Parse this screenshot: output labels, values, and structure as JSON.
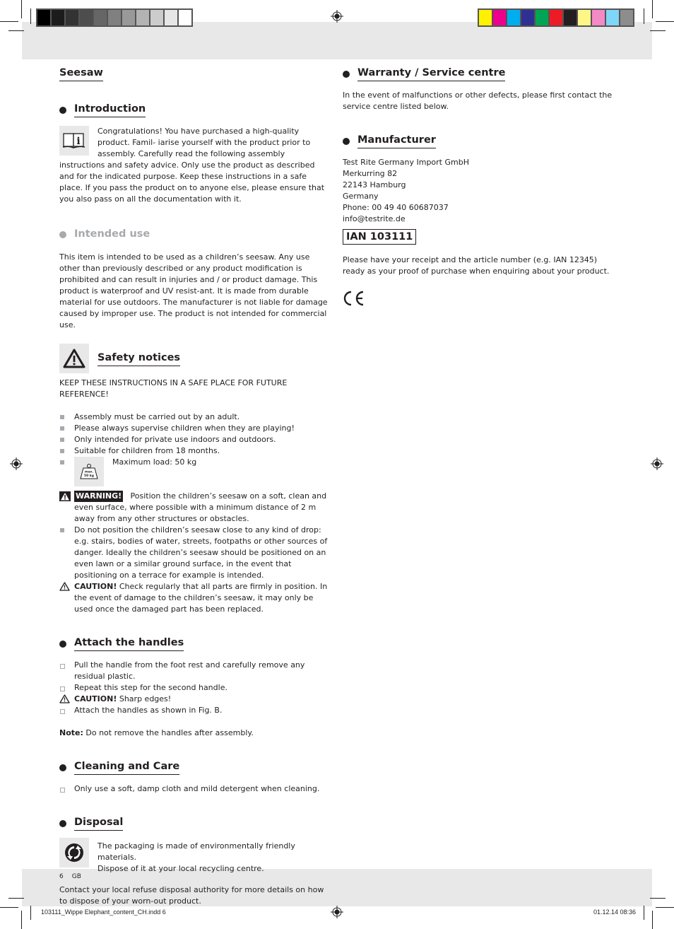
{
  "print_marks": {
    "grey_swatches": [
      "#000000",
      "#1c1c1c",
      "#333333",
      "#4d4d4d",
      "#666666",
      "#808080",
      "#999999",
      "#b3b3b3",
      "#cccccc",
      "#e6e6e6",
      "#ffffff"
    ],
    "color_swatches": [
      "#fff200",
      "#ec008c",
      "#00aeef",
      "#2e3192",
      "#00a651",
      "#ed1c24",
      "#231f20",
      "#fff688",
      "#f389c5",
      "#7fd6f7",
      "#8d8d8d"
    ],
    "slug_file": "103111_Wippe Elephant_content_CH.indd   6",
    "slug_date": "01.12.14   08:36"
  },
  "page_title": "Seesaw",
  "introduction": {
    "heading": "Introduction",
    "icon": "info-book-icon",
    "text_wrapped": [
      "Congratulations! You have purchased a high-quality product. Famil-",
      "iarise yourself with the product prior to assembly. Carefully read",
      "the following assembly instructions and safety advice. Only use the"
    ],
    "text_rest": "product as described and for the indicated purpose. Keep these instructions in a safe place. If you pass the product on to anyone else, please ensure that you also pass on all the documentation with it."
  },
  "intended_use": {
    "heading": "Intended use",
    "text": "This item is intended to be used as a children’s seesaw. Any use other than previously described or any product modification is prohibited and can result in injuries and / or product damage. This product is waterproof and UV resist-ant. It is made from durable material for use outdoors. The manufacturer is not liable for damage caused by improper use. The product is not intended for commercial use."
  },
  "safety": {
    "heading": "Safety notices",
    "icon": "warning-triangle-icon",
    "keep": "KEEP THESE INSTRUCTIONS IN A SAFE PLACE FOR FUTURE REFERENCE!",
    "items": [
      "Assembly must be carried out by an adult.",
      "Please always supervise children when they are playing!",
      "Only intended for private use indoors and outdoors.",
      "Suitable for children from 18 months."
    ],
    "max_load": "Maximum load: 50 kg",
    "weight_icon_label_1": "max.",
    "weight_icon_label_2": "50 kg",
    "warning_label": "WARNING!",
    "warning_text": " Position the children’s seesaw on a soft, clean and even surface, where possible with a minimum distance of 2 m away from any other structures or obstacles.",
    "drop_item": "Do not position the children’s seesaw close to any kind of drop: e.g. stairs, bodies of water, streets, footpaths or other sources of danger. Ideally the children’s seesaw should be positioned on an even lawn or a similar ground surface, in the event that positioning on a terrace for example is intended.",
    "caution_label": "CAUTION!",
    "caution_text": " Check regularly that all parts are firmly in position. In the event of damage to the children’s seesaw, it may only be used once the damaged part has been replaced."
  },
  "handles": {
    "heading": "Attach the handles",
    "step1": "Pull the handle from the foot rest and carefully remove any residual plastic.",
    "step2": "Repeat this step for the second handle.",
    "caution_label": "CAUTION!",
    "caution_text": " Sharp edges!",
    "step3": "Attach the handles as shown in Fig. B.",
    "note_label": "Note:",
    "note_text": " Do not remove the handles after assembly."
  },
  "cleaning": {
    "heading": "Cleaning and Care",
    "item": "Only use a soft, damp cloth and mild detergent when cleaning."
  },
  "disposal": {
    "heading": "Disposal",
    "icon": "green-dot-recycling-icon",
    "line1": "The packaging is made of environmentally friendly materials.",
    "line2": "Dispose of it at your local recycling centre.",
    "text": "Contact your local refuse disposal authority for more details on how to dispose of your worn-out product."
  },
  "warranty": {
    "heading": "Warranty / Service centre",
    "text": "In the event of malfunctions or other defects, please first contact the service centre listed below."
  },
  "manufacturer": {
    "heading": "Manufacturer",
    "lines": [
      "Test Rite Germany Import GmbH",
      "Merkurring 82",
      "22143 Hamburg",
      "Germany",
      "Phone: 00 49 40 60687037",
      "info@testrite.de"
    ],
    "ian": "IAN 103111",
    "receipt": "Please have your receipt and the article number (e.g. IAN 12345) ready as your proof of purchase when enquiring about your product.",
    "ce_mark": "CE"
  },
  "footer": {
    "page_number": "6",
    "language": "GB"
  }
}
